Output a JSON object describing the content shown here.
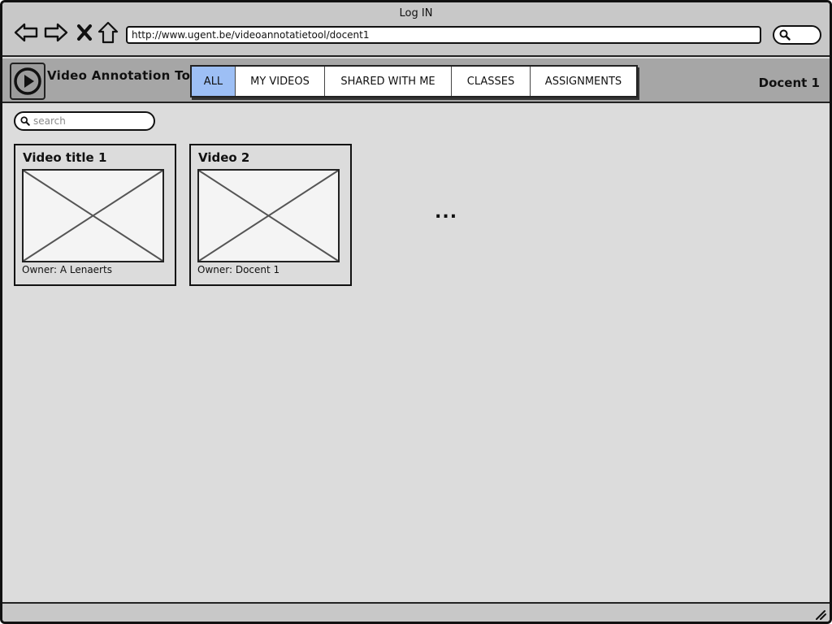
{
  "browser": {
    "window_title": "Log IN",
    "url": "http://www.ugent.be/videoannotatietool/docent1",
    "icons": [
      "back-arrow-icon",
      "forward-arrow-icon",
      "close-x-icon",
      "home-icon",
      "search-icon"
    ]
  },
  "header": {
    "app_title": "Video Annotation Tool",
    "logo_icon": "play-circle-icon",
    "user_name": "Docent 1",
    "tabs": [
      {
        "label": "ALL",
        "active": true
      },
      {
        "label": "MY VIDEOS",
        "active": false
      },
      {
        "label": "SHARED WITH ME",
        "active": false
      },
      {
        "label": "CLASSES",
        "active": false
      },
      {
        "label": "ASSIGNMENTS",
        "active": false
      }
    ]
  },
  "search": {
    "placeholder": "search",
    "value": ""
  },
  "videos": [
    {
      "title": "Video title 1",
      "owner": "Owner: A Lenaerts"
    },
    {
      "title": "Video 2",
      "owner": "Owner: Docent 1"
    }
  ],
  "more_label": "...",
  "colors": {
    "background": "#dcdcdc",
    "chrome": "#c8c8c8",
    "header": "#a6a6a6",
    "active_tab": "#9dbff5"
  }
}
